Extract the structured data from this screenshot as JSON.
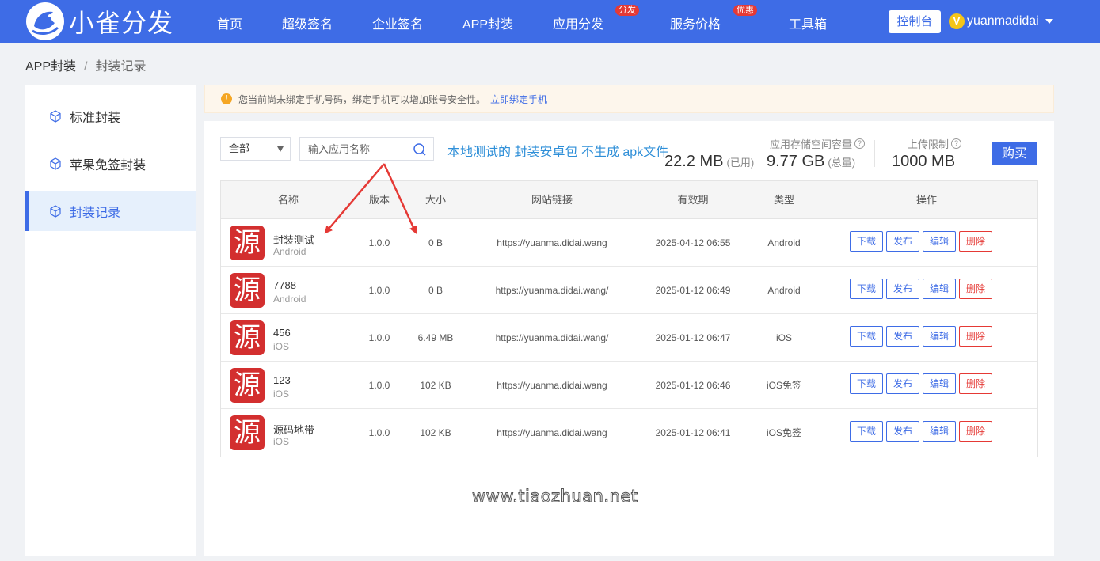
{
  "brand": {
    "name": "小雀分发"
  },
  "nav": {
    "items": [
      {
        "label": "首页"
      },
      {
        "label": "超级签名"
      },
      {
        "label": "企业签名"
      },
      {
        "label": "APP封装"
      },
      {
        "label": "应用分发",
        "badge": "分发"
      },
      {
        "label": "服务价格",
        "badge": "优惠"
      },
      {
        "label": "工具箱"
      }
    ],
    "console_label": "控制台",
    "user_initial": "V",
    "username": "yuanmadidai"
  },
  "breadcrumb": {
    "parent": "APP封装",
    "separator": "/",
    "current": "封装记录"
  },
  "sidebar": {
    "items": [
      {
        "label": "标准封装",
        "icon": "cube-icon"
      },
      {
        "label": "苹果免签封装",
        "icon": "cube-icon"
      },
      {
        "label": "封装记录",
        "icon": "cube-icon",
        "active": true
      }
    ]
  },
  "notice": {
    "text": "您当前尚未绑定手机号码，绑定手机可以增加账号安全性。",
    "link": "立即绑定手机",
    "icon": "warning-icon"
  },
  "filters": {
    "type_select": "全部",
    "search_placeholder": "输入应用名称",
    "hint": "本地测试的 封装安卓包 不生成 apk文件"
  },
  "stats": {
    "storage_label": "应用存储空间容量",
    "used_value": "22.2 MB",
    "used_suffix": "(已用)",
    "total_value": "9.77 GB",
    "total_suffix": "(总量)",
    "upload_label": "上传限制",
    "upload_value": "1000 MB",
    "help_icon": "?",
    "buy_label": "购买"
  },
  "table": {
    "columns": [
      "名称",
      "版本",
      "大小",
      "网站链接",
      "有效期",
      "类型",
      "操作"
    ],
    "actions": [
      "下载",
      "发布",
      "编辑",
      "删除"
    ],
    "rows": [
      {
        "icon_char": "源",
        "name": "封装测试",
        "platform": "Android",
        "version": "1.0.0",
        "size": "0 B",
        "url": "https://yuanma.didai.wang",
        "expiry": "2025-04-12 06:55",
        "type": "Android"
      },
      {
        "icon_char": "源",
        "name": "7788",
        "platform": "Android",
        "version": "1.0.0",
        "size": "0 B",
        "url": "https://yuanma.didai.wang/",
        "expiry": "2025-01-12 06:49",
        "type": "Android"
      },
      {
        "icon_char": "源",
        "name": "456",
        "platform": "iOS",
        "version": "1.0.0",
        "size": "6.49 MB",
        "url": "https://yuanma.didai.wang/",
        "expiry": "2025-01-12 06:47",
        "type": "iOS"
      },
      {
        "icon_char": "源",
        "name": "123",
        "platform": "iOS",
        "version": "1.0.0",
        "size": "102 KB",
        "url": "https://yuanma.didai.wang",
        "expiry": "2025-01-12 06:46",
        "type": "iOS免签"
      },
      {
        "icon_char": "源",
        "name": "源码地带",
        "platform": "iOS",
        "version": "1.0.0",
        "size": "102 KB",
        "url": "https://yuanma.didai.wang",
        "expiry": "2025-01-12 06:41",
        "type": "iOS免签"
      }
    ]
  },
  "watermark": "www.tiaozhuan.net",
  "colors": {
    "primary": "#3e6ce6",
    "danger": "#e53935",
    "hint": "#2f8fd8",
    "annotation": "#e53935"
  }
}
